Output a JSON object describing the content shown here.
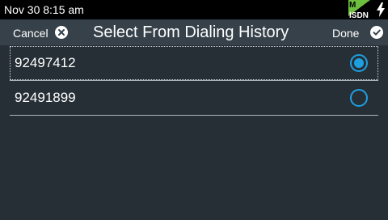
{
  "status": {
    "datetime": "Nov 30 8:15 am",
    "isdn_top": "M",
    "isdn_bottom": "ISDN",
    "isdn_color": "#6fbf3f"
  },
  "header": {
    "cancel_label": "Cancel",
    "title": "Select From Dialing History",
    "done_label": "Done"
  },
  "history": [
    {
      "number": "92497412",
      "selected": true
    },
    {
      "number": "92491899",
      "selected": false
    }
  ],
  "colors": {
    "accent": "#1e9fe0",
    "background": "#262f36",
    "header": "#36414a"
  }
}
